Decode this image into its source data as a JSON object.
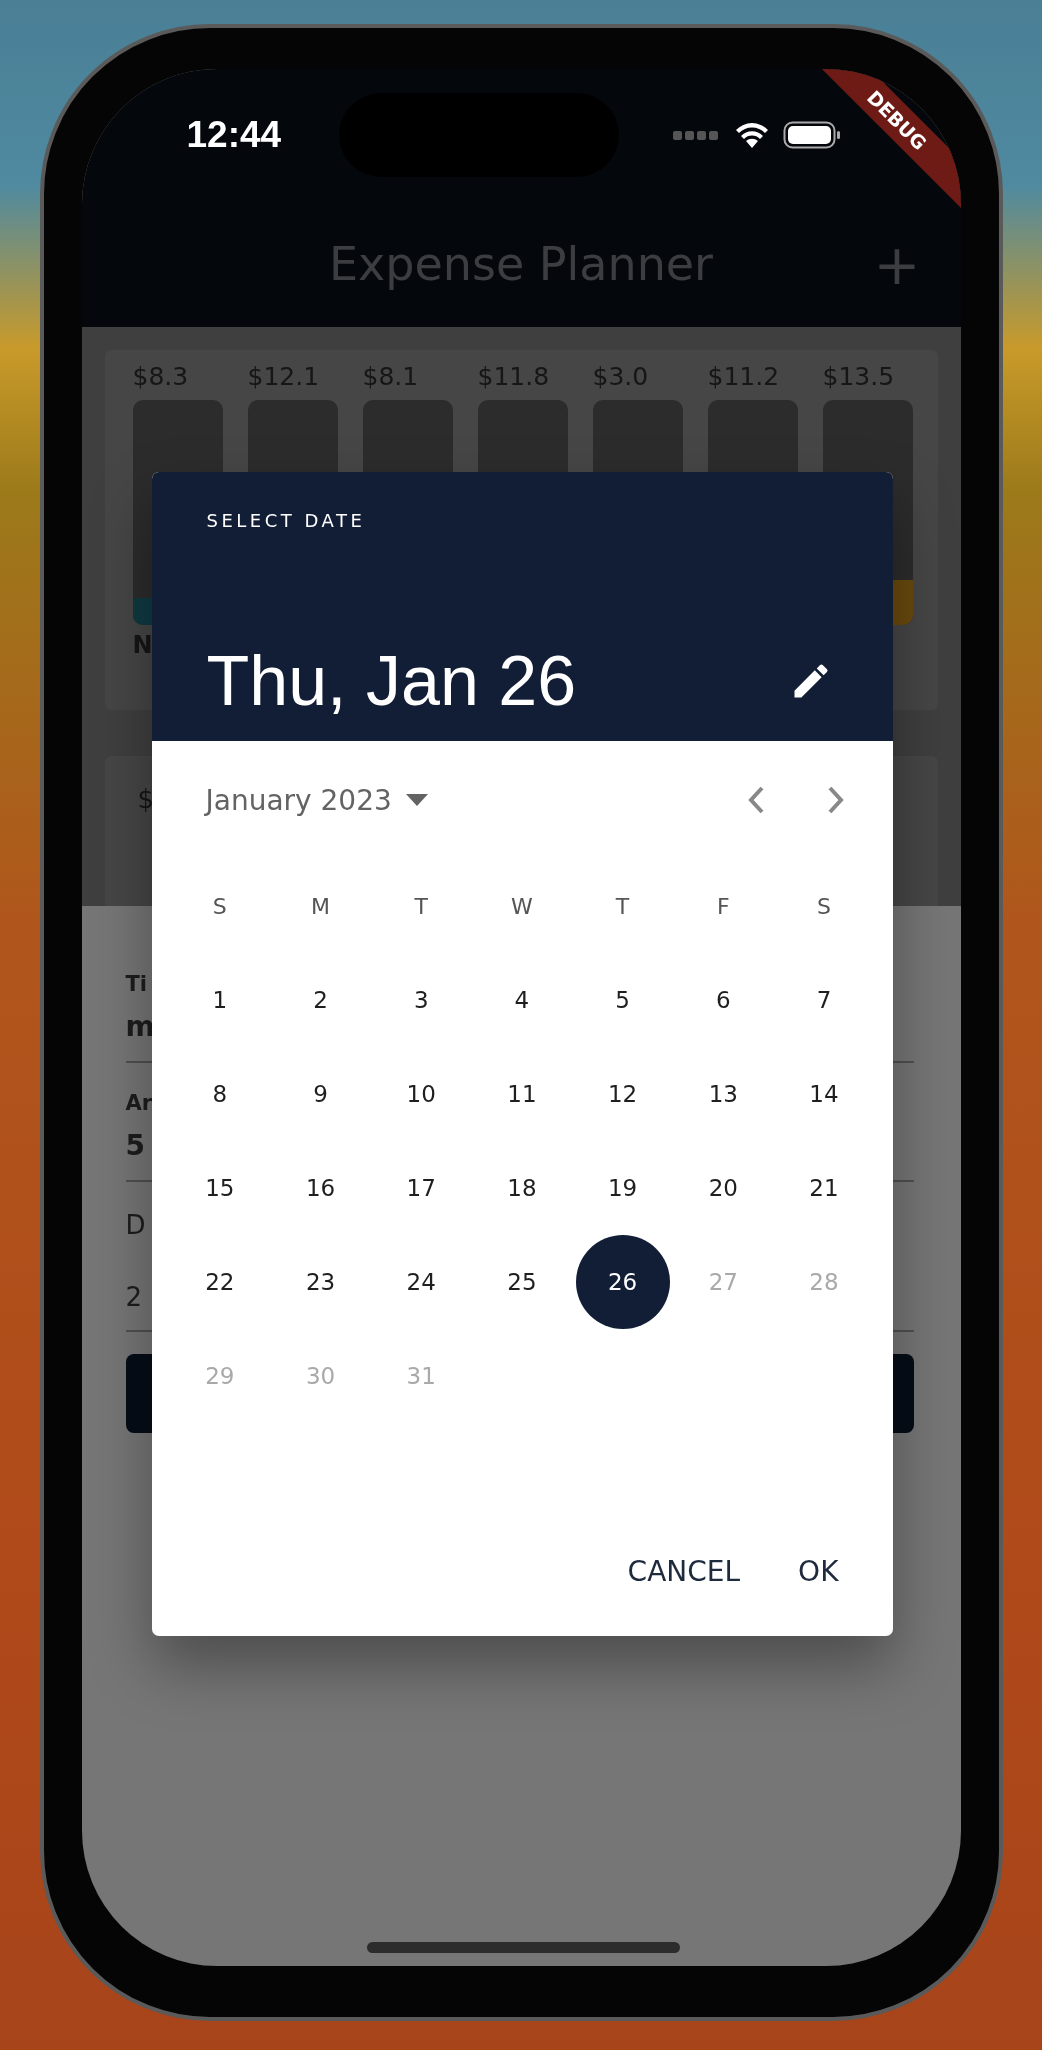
{
  "status_bar": {
    "time": "12:44"
  },
  "debug_banner": {
    "label": "DEBUG"
  },
  "app_bar": {
    "title": "Expense Planner",
    "action": "+"
  },
  "chart": {
    "bars": [
      {
        "amount": "$8.3",
        "label": "N",
        "level": 0.12,
        "color": "#0f3a42"
      },
      {
        "amount": "$12.1"
      },
      {
        "amount": "$8.1"
      },
      {
        "amount": "$11.8"
      },
      {
        "amount": "$3.0"
      },
      {
        "amount": "$11.2"
      },
      {
        "amount": "$13.5",
        "level": 0.2,
        "color": "#6a4a0e"
      }
    ]
  },
  "summary_card": {
    "text": "$"
  },
  "form": {
    "fields": [
      {
        "kind": "text",
        "label": "Ti",
        "value": "m"
      },
      {
        "kind": "text",
        "label": "Ar",
        "value": "5"
      },
      {
        "kind": "picker",
        "label": "D",
        "value": "2"
      }
    ]
  },
  "date_dialog": {
    "title": "SELECT DATE",
    "selected_date": "Thu, Jan 26",
    "month": "January 2023",
    "weekdays": [
      "S",
      "M",
      "T",
      "W",
      "T",
      "F",
      "S"
    ],
    "days": [
      {
        "label": "1",
        "selected": false,
        "disabled": false
      },
      {
        "label": "2",
        "selected": false,
        "disabled": false
      },
      {
        "label": "3",
        "selected": false,
        "disabled": false
      },
      {
        "label": "4",
        "selected": false,
        "disabled": false
      },
      {
        "label": "5",
        "selected": false,
        "disabled": false
      },
      {
        "label": "6",
        "selected": false,
        "disabled": false
      },
      {
        "label": "7",
        "selected": false,
        "disabled": false
      },
      {
        "label": "8",
        "selected": false,
        "disabled": false
      },
      {
        "label": "9",
        "selected": false,
        "disabled": false
      },
      {
        "label": "10",
        "selected": false,
        "disabled": false
      },
      {
        "label": "11",
        "selected": false,
        "disabled": false
      },
      {
        "label": "12",
        "selected": false,
        "disabled": false
      },
      {
        "label": "13",
        "selected": false,
        "disabled": false
      },
      {
        "label": "14",
        "selected": false,
        "disabled": false
      },
      {
        "label": "15",
        "selected": false,
        "disabled": false
      },
      {
        "label": "16",
        "selected": false,
        "disabled": false
      },
      {
        "label": "17",
        "selected": false,
        "disabled": false
      },
      {
        "label": "18",
        "selected": false,
        "disabled": false
      },
      {
        "label": "19",
        "selected": false,
        "disabled": false
      },
      {
        "label": "20",
        "selected": false,
        "disabled": false
      },
      {
        "label": "21",
        "selected": false,
        "disabled": false
      },
      {
        "label": "22",
        "selected": false,
        "disabled": false
      },
      {
        "label": "23",
        "selected": false,
        "disabled": false
      },
      {
        "label": "24",
        "selected": false,
        "disabled": false
      },
      {
        "label": "25",
        "selected": false,
        "disabled": false
      },
      {
        "label": "26",
        "selected": true,
        "disabled": false
      },
      {
        "label": "27",
        "selected": false,
        "disabled": true
      },
      {
        "label": "28",
        "selected": false,
        "disabled": true
      },
      {
        "label": "29",
        "selected": false,
        "disabled": true
      },
      {
        "label": "30",
        "selected": false,
        "disabled": true
      },
      {
        "label": "31",
        "selected": false,
        "disabled": true
      }
    ],
    "buttons": [
      "CANCEL",
      "OK"
    ]
  }
}
